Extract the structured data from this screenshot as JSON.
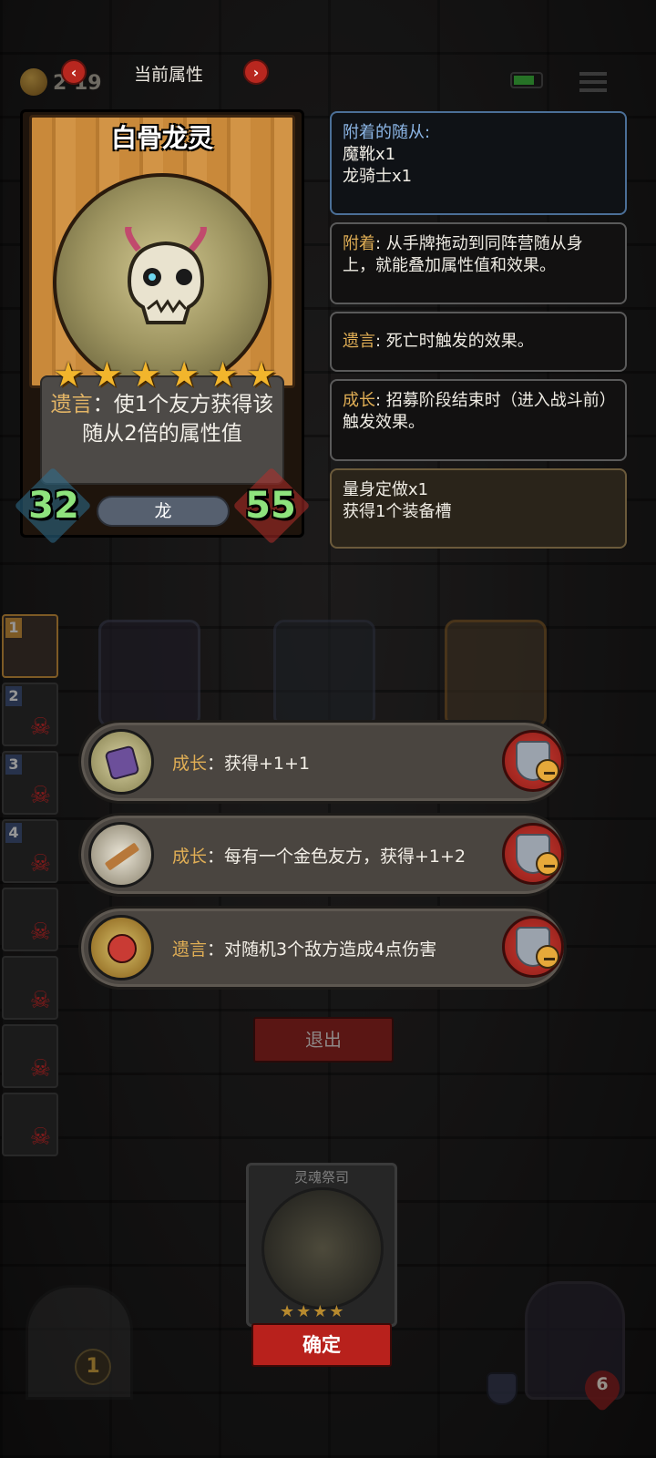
{
  "top": {
    "gold": "2 19",
    "title": "当前属性",
    "prev": "‹",
    "next": "›"
  },
  "card": {
    "name": "白骨龙灵",
    "stars": 6,
    "desc_keyword": "遗言",
    "desc_text": "：使1个友方获得该随从2倍的属性值",
    "attack": "32",
    "health": "55",
    "tribe": "龙"
  },
  "panels": {
    "attached": {
      "title": "附着的随从:",
      "items": [
        "魔靴x1",
        "龙骑士x1"
      ]
    },
    "attach": {
      "keyword": "附着",
      "text": ": 从手牌拖动到同阵营随从身上，就能叠加属性值和效果。"
    },
    "deathrattle": {
      "keyword": "遗言",
      "text": ": 死亡时触发的效果。"
    },
    "growth": {
      "keyword": "成长",
      "text": ": 招募阶段结束时（进入战斗前）触发效果。"
    },
    "tailored": {
      "line1": "量身定做x1",
      "line2": "获得1个装备槽"
    }
  },
  "roster": [
    "1",
    "2",
    "3",
    "4",
    "",
    "",
    "",
    ""
  ],
  "effects": [
    {
      "keyword": "成长",
      "text": "：获得+1+1",
      "icon": "purple-book-icon"
    },
    {
      "keyword": "成长",
      "text": "：每有一个金色友方，获得+1+2",
      "icon": "golden-arrow-icon"
    },
    {
      "keyword": "遗言",
      "text": "：对随机3个敌方造成4点伤害",
      "icon": "bomb-icon"
    }
  ],
  "buttons": {
    "exit": "退出",
    "confirm": "确定"
  },
  "bottom_card": {
    "title": "灵魂祭司",
    "stars": "★★★★"
  },
  "hero": {
    "hp": "6",
    "door_coin": "1"
  },
  "colors": {
    "keyword": "#e0ae55",
    "stat": "#8ee37d",
    "confirm": "#b8211c"
  }
}
